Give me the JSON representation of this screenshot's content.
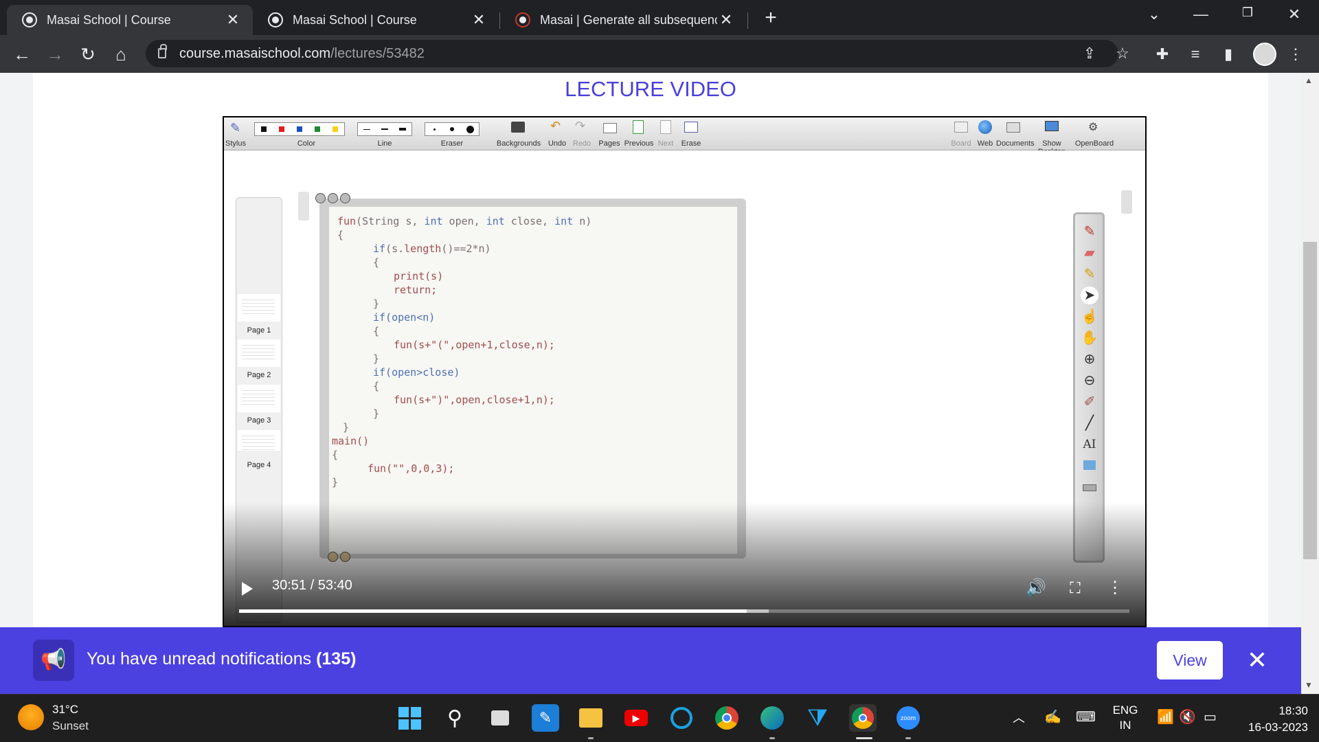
{
  "browser": {
    "tabs": [
      {
        "title": "Masai School | Course",
        "active": true
      },
      {
        "title": "Masai School | Course",
        "active": false
      },
      {
        "title": "Masai | Generate all subsequence",
        "active": false
      }
    ],
    "new_tab_symbol": "+",
    "url_domain": "course.masaischool.com",
    "url_path": "/lectures/53482"
  },
  "page": {
    "title": "LECTURE VIDEO"
  },
  "openboard": {
    "toolbar": [
      {
        "label": "Stylus"
      },
      {
        "label": "Color"
      },
      {
        "label": "Line"
      },
      {
        "label": "Eraser"
      },
      {
        "label": "Backgrounds"
      },
      {
        "label": "Undo"
      },
      {
        "label": "Redo"
      },
      {
        "label": "Pages"
      },
      {
        "label": "Previous"
      },
      {
        "label": "Next"
      },
      {
        "label": "Erase"
      },
      {
        "label": "Board"
      },
      {
        "label": "Web"
      },
      {
        "label": "Documents"
      },
      {
        "label": "Show Desktop"
      },
      {
        "label": "OpenBoard"
      }
    ],
    "colors": [
      "#111111",
      "#e31b1b",
      "#1b4fbf",
      "#1e8a2e",
      "#f5d01b"
    ],
    "pages": [
      "Page 1",
      "Page 2",
      "Page 3",
      "Page 4"
    ],
    "code_lines": [
      "fun(String s, int open, int close, int n)",
      "{",
      "if(s.length()==2*n)",
      "{",
      "print(s)",
      "return;",
      "}",
      "if(open<n)",
      "{",
      "fun(s+\"(\",open+1,close,n);",
      "}",
      "if(open>close)",
      "{",
      "fun(s+\")\",open,close+1,n);",
      "}",
      "}",
      "main()",
      "{",
      "fun(\"\",0,0,3);",
      "}"
    ],
    "palette_text_tool": "AI"
  },
  "video": {
    "time": "30:51 / 53:40",
    "progress": 0.57,
    "buffered": 0.595
  },
  "notification": {
    "text": "You have unread notifications",
    "count": "(135)",
    "view_label": "View"
  },
  "taskbar": {
    "temperature": "31°C",
    "condition": "Sunset",
    "language_line1": "ENG",
    "language_line2": "IN",
    "time": "18:30",
    "date": "16-03-2023"
  }
}
